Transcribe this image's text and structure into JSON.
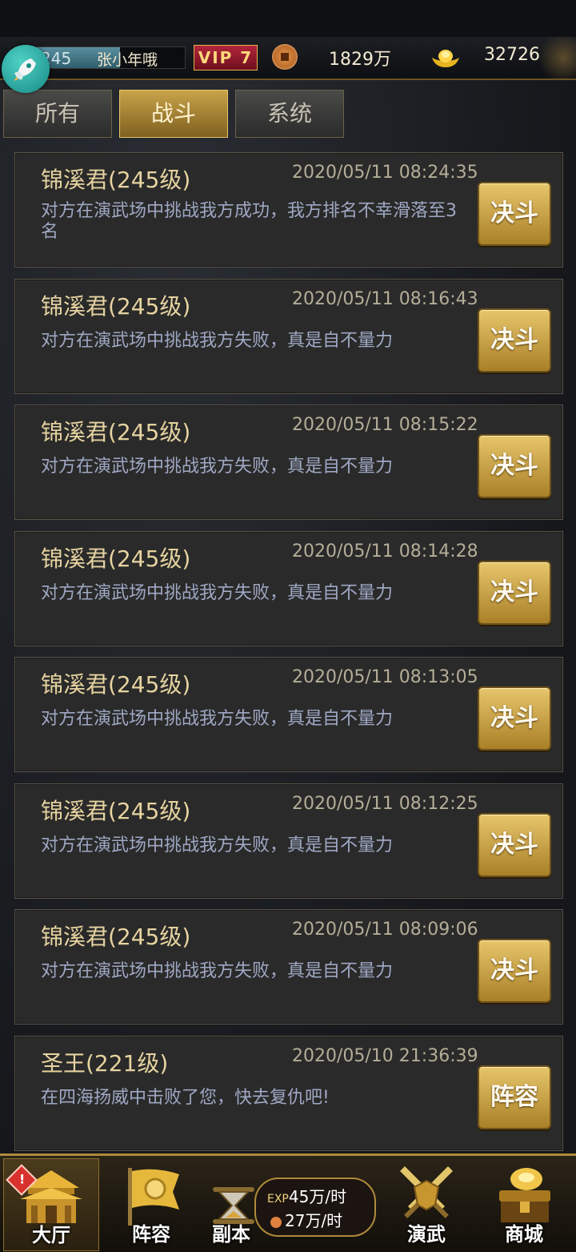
{
  "header": {
    "level_text": "245",
    "username": "张小年哦",
    "level_progress_pct": 62,
    "vip": "VIP 7",
    "copper_amount": "1829万",
    "gold_amount": "32726"
  },
  "tabs": [
    {
      "label": "所有"
    },
    {
      "label": "战斗"
    },
    {
      "label": "系统"
    }
  ],
  "records": [
    {
      "name": "锦溪君(245级)",
      "time": "2020/05/11 08:24:35",
      "message": "对方在演武场中挑战我方成功，我方排名不幸滑落至3名",
      "button": "决斗"
    },
    {
      "name": "锦溪君(245级)",
      "time": "2020/05/11 08:16:43",
      "message": "对方在演武场中挑战我方失败，真是自不量力",
      "button": "决斗"
    },
    {
      "name": "锦溪君(245级)",
      "time": "2020/05/11 08:15:22",
      "message": "对方在演武场中挑战我方失败，真是自不量力",
      "button": "决斗"
    },
    {
      "name": "锦溪君(245级)",
      "time": "2020/05/11 08:14:28",
      "message": "对方在演武场中挑战我方失败，真是自不量力",
      "button": "决斗"
    },
    {
      "name": "锦溪君(245级)",
      "time": "2020/05/11 08:13:05",
      "message": "对方在演武场中挑战我方失败，真是自不量力",
      "button": "决斗"
    },
    {
      "name": "锦溪君(245级)",
      "time": "2020/05/11 08:12:25",
      "message": "对方在演武场中挑战我方失败，真是自不量力",
      "button": "决斗"
    },
    {
      "name": "锦溪君(245级)",
      "time": "2020/05/11 08:09:06",
      "message": "对方在演武场中挑战我方失败，真是自不量力",
      "button": "决斗"
    },
    {
      "name": "圣王(221级)",
      "time": "2020/05/10 21:36:39",
      "message": "在四海扬威中击败了您，快去复仇吧!",
      "button": "阵容"
    }
  ],
  "nav": {
    "hall": "大厅",
    "lineup": "阵容",
    "dungeon": "副本",
    "exp_prefix": "EXP",
    "exp_rate": "45万/时",
    "copper_rate": "27万/时",
    "arena": "演武",
    "shop": "商城",
    "badge": "!"
  },
  "colors": {
    "gold": "#c8a349",
    "vip_red": "#b3263b",
    "message_text": "#9fa8c4"
  }
}
